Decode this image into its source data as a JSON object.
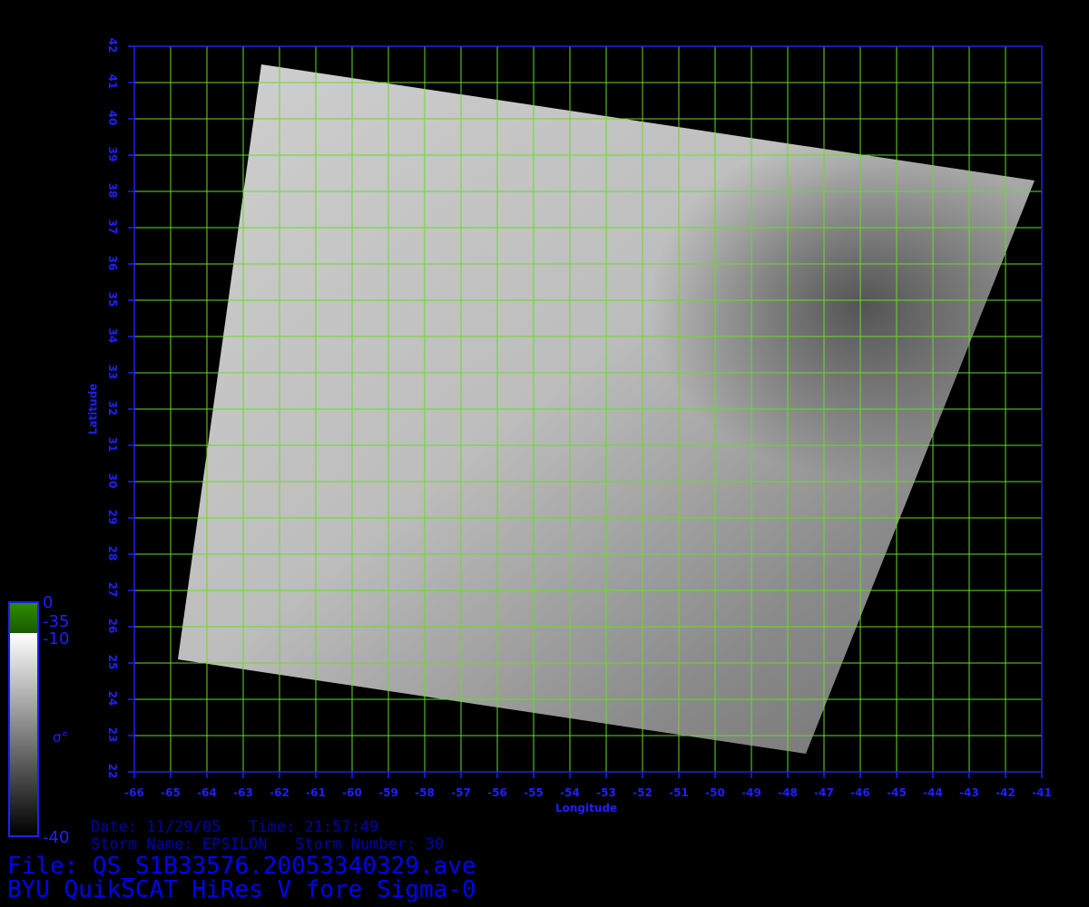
{
  "map": {
    "xlabel": "Longitude",
    "ylabel": "Latitude",
    "lon_ticks": [
      -66,
      -65,
      -64,
      -63,
      -62,
      -61,
      -60,
      -59,
      -58,
      -57,
      -56,
      -55,
      -54,
      -53,
      -52,
      -51,
      -50,
      -49,
      -48,
      -47,
      -46,
      -45,
      -44,
      -43,
      -42,
      -41
    ],
    "lat_ticks": [
      22,
      23,
      24,
      25,
      26,
      27,
      28,
      29,
      30,
      31,
      32,
      33,
      34,
      35,
      36,
      37,
      38,
      39,
      40,
      41,
      42
    ],
    "lon_range": [
      -66,
      -41
    ],
    "lat_range": [
      22,
      42
    ],
    "swath_corners": [
      [
        -62.5,
        41.5
      ],
      [
        -41.2,
        38.3
      ],
      [
        -47.5,
        22.5
      ],
      [
        -64.8,
        25.1
      ]
    ],
    "colors": {
      "grid": "#66dd22",
      "axis": "#1f1fff",
      "background": "#000000"
    }
  },
  "colorbar": {
    "labels": [
      "0",
      "-35",
      "-10",
      "σ°",
      "-40"
    ]
  },
  "info": {
    "date_line": "Date: 11/29/05   Time: 21:57:49",
    "storm_line": "Storm Name: EPSILON   Storm Number: 30",
    "file_line": "File: QS_S1B33576.20053340329.ave",
    "product_line": "BYU QuikSCAT HiRes V fore Sigma-0"
  }
}
